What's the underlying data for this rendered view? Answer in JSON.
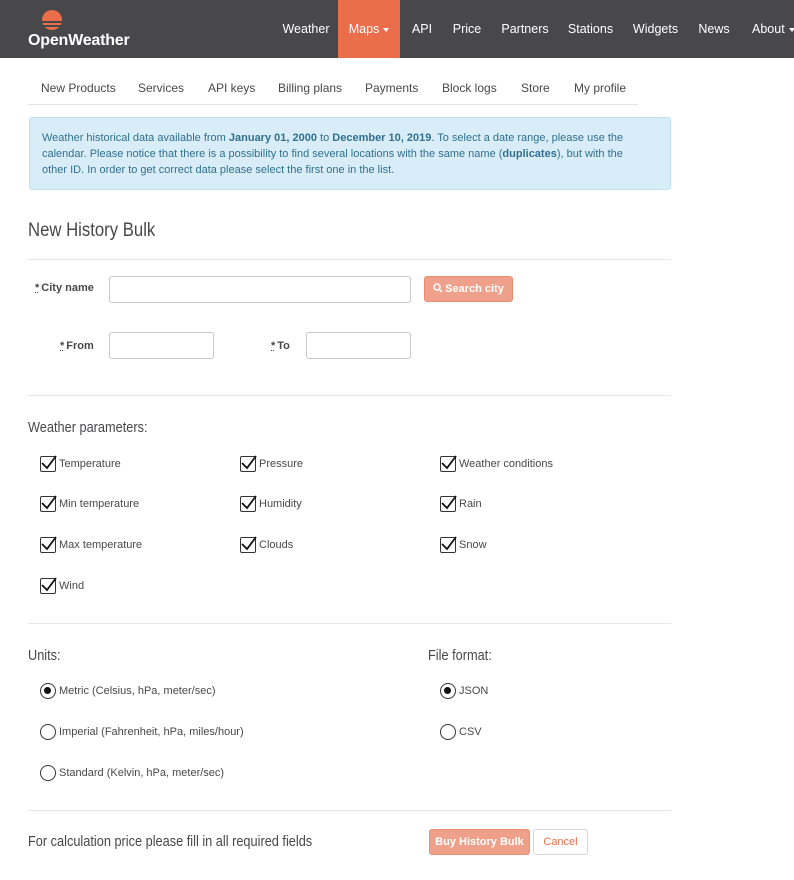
{
  "app": {
    "brand": "OpenWeather",
    "accent_color": "#eb6e4b",
    "topbar_color": "#48484a"
  },
  "topnav": [
    {
      "label": "Weather",
      "active": false,
      "dropdown": false
    },
    {
      "label": "Maps",
      "active": true,
      "dropdown": true
    },
    {
      "label": "API",
      "active": false,
      "dropdown": false
    },
    {
      "label": "Price",
      "active": false,
      "dropdown": false
    },
    {
      "label": "Partners",
      "active": false,
      "dropdown": false
    },
    {
      "label": "Stations",
      "active": false,
      "dropdown": false
    },
    {
      "label": "Widgets",
      "active": false,
      "dropdown": false
    },
    {
      "label": "News",
      "active": false,
      "dropdown": false
    },
    {
      "label": "About",
      "active": false,
      "dropdown": true
    }
  ],
  "subnav": [
    "New Products",
    "Services",
    "API keys",
    "Billing plans",
    "Payments",
    "Block logs",
    "Store",
    "My profile"
  ],
  "info": {
    "p1": "Weather historical data available from ",
    "date_from": "January 01, 2000",
    "p2": " to ",
    "date_to": "December 10, 2019",
    "p3": ". To select a date range, please use the",
    "line2a": "calendar. Please notice that there is a possibility to find several locations with the same name (",
    "duplicates": "duplicates",
    "line2b": "), but with the",
    "line3": "other ID. In order to get correct data please select the first one in the list."
  },
  "form": {
    "title": "New History Bulk",
    "required_mark": "*",
    "city_label": "City name",
    "city_value": "",
    "search_button": "Search city",
    "from_label": "From",
    "from_value": "",
    "to_label": "To",
    "to_value": ""
  },
  "weather_params": {
    "title": "Weather parameters:",
    "items": [
      {
        "label": "Temperature",
        "checked": true
      },
      {
        "label": "Pressure",
        "checked": true
      },
      {
        "label": "Weather conditions",
        "checked": true
      },
      {
        "label": "Min temperature",
        "checked": true
      },
      {
        "label": "Humidity",
        "checked": true
      },
      {
        "label": "Rain",
        "checked": true
      },
      {
        "label": "Max temperature",
        "checked": true
      },
      {
        "label": "Clouds",
        "checked": true
      },
      {
        "label": "Snow",
        "checked": true
      },
      {
        "label": "Wind",
        "checked": true
      }
    ]
  },
  "units": {
    "title": "Units:",
    "options": [
      {
        "label": "Metric (Celsius, hPa, meter/sec)",
        "selected": true
      },
      {
        "label": "Imperial (Fahrenheit, hPa, miles/hour)",
        "selected": false
      },
      {
        "label": "Standard (Kelvin, hPa, meter/sec)",
        "selected": false
      }
    ]
  },
  "file_format": {
    "title": "File format:",
    "options": [
      {
        "label": "JSON",
        "selected": true
      },
      {
        "label": "CSV",
        "selected": false
      }
    ]
  },
  "footer": {
    "note": "For calculation price please fill in all required fields",
    "buy_button": "Buy History Bulk",
    "cancel_button": "Cancel"
  }
}
